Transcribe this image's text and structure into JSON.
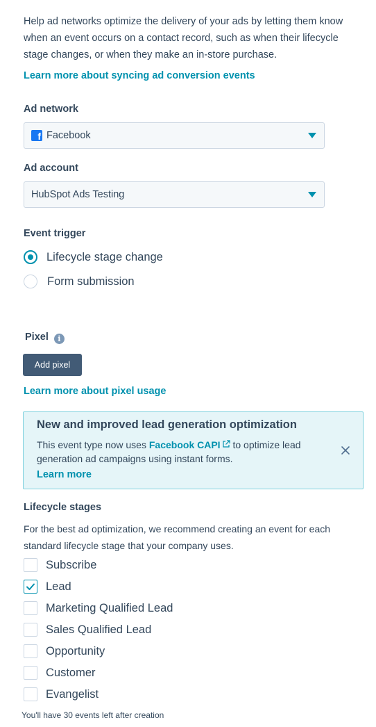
{
  "intro": {
    "text": "Help ad networks optimize the delivery of your ads by letting them know when an event occurs on a contact record, such as when their lifecycle stage changes,  or when they make an in-store purchase.",
    "link": "Learn more about syncing ad conversion events"
  },
  "ad_network": {
    "label": "Ad network",
    "value": "Facebook",
    "icon": "facebook-icon"
  },
  "ad_account": {
    "label": "Ad account",
    "value": "HubSpot Ads Testing"
  },
  "event_trigger": {
    "label": "Event trigger",
    "options": [
      {
        "label": "Lifecycle stage change",
        "checked": true
      },
      {
        "label": "Form submission",
        "checked": false
      }
    ]
  },
  "pixel": {
    "label": "Pixel",
    "info_glyph": "i",
    "button": "Add pixel",
    "link": "Learn more about pixel usage"
  },
  "callout": {
    "title": "New and improved lead generation optimization",
    "body_before": "This event type now uses ",
    "body_link": "Facebook CAPI",
    "body_after": " to optimize lead generation ad campaigns using instant forms.",
    "link": "Learn more"
  },
  "lifecycle": {
    "label": "Lifecycle stages",
    "description": "For the best ad optimization, we recommend creating an event for each standard lifecycle stage that your company uses.",
    "stages": [
      {
        "label": "Subscribe",
        "checked": false
      },
      {
        "label": "Lead",
        "checked": true
      },
      {
        "label": "Marketing Qualified Lead",
        "checked": false
      },
      {
        "label": "Sales Qualified Lead",
        "checked": false
      },
      {
        "label": "Opportunity",
        "checked": false
      },
      {
        "label": "Customer",
        "checked": false
      },
      {
        "label": "Evangelist",
        "checked": false
      }
    ]
  },
  "footer_note": "You'll have 30 events left after creation",
  "colors": {
    "accent": "#0091ae",
    "text": "#33475b",
    "button_dark": "#425b76",
    "callout_bg": "#e5f5f8",
    "callout_border": "#7fd1de"
  }
}
